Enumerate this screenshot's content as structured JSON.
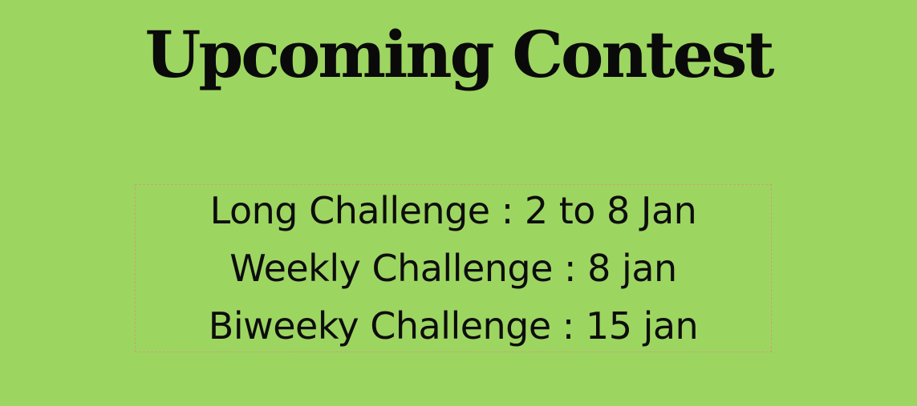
{
  "title": "Upcoming Contest",
  "contests": [
    {
      "text": "Long Challenge : 2 to 8 Jan"
    },
    {
      "text": "Weekly Challenge : 8 jan"
    },
    {
      "text": "Biweeky Challenge : 15 jan"
    }
  ],
  "colors": {
    "background": "#9dd561",
    "text": "#0a0a0a",
    "box_border": "#c9a277"
  }
}
